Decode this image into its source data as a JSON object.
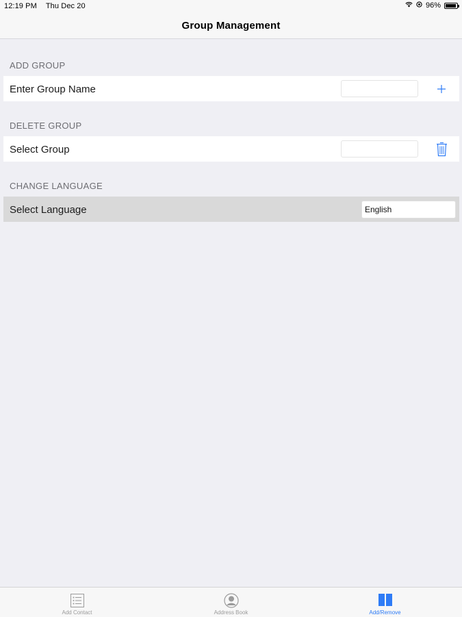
{
  "status_bar": {
    "time": "12:19 PM",
    "date": "Thu Dec 20",
    "battery": "96%",
    "battery_level": 0.96
  },
  "nav": {
    "title": "Group Management"
  },
  "sections": {
    "add_group": {
      "header": "ADD GROUP",
      "label": "Enter Group Name",
      "field_value": ""
    },
    "delete_group": {
      "header": "DELETE GROUP",
      "label": "Select Group",
      "field_value": ""
    },
    "change_language": {
      "header": "CHANGE LANGUAGE",
      "label": "Select Language",
      "value": "English"
    }
  },
  "tabs": [
    {
      "label": "Add Contact",
      "icon": "list-icon",
      "active": false
    },
    {
      "label": "Address Book",
      "icon": "person-icon",
      "active": false
    },
    {
      "label": "Add/Remove",
      "icon": "book-icon",
      "active": true
    }
  ],
  "colors": {
    "accent": "#2f7cf6",
    "background": "#efeff4",
    "header_text": "#6d6d72"
  }
}
